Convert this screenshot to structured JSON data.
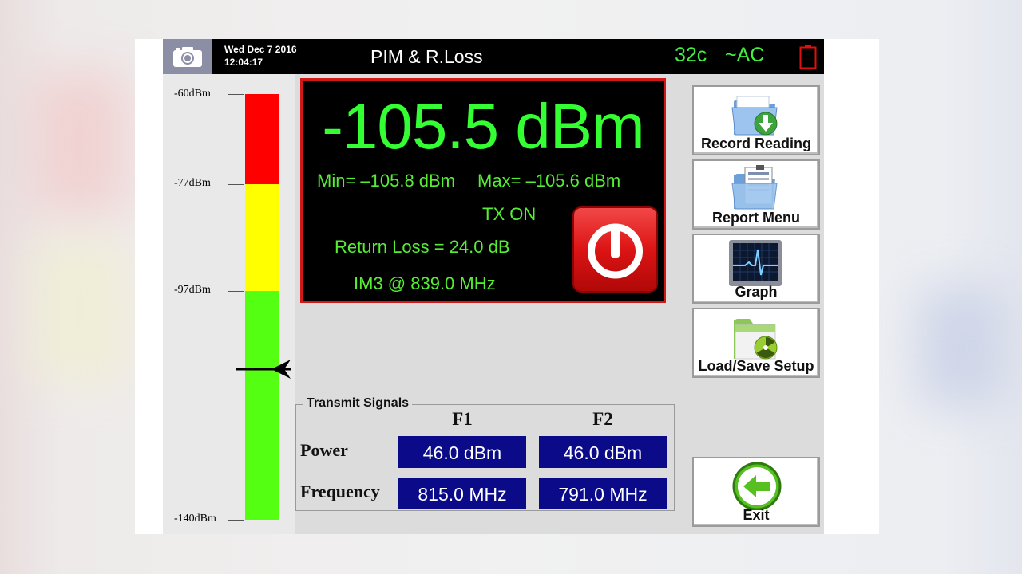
{
  "status_bar": {
    "date": "Wed Dec 7 2016",
    "time": "12:04:17",
    "title": "PIM & R.Loss",
    "temperature": "32c",
    "power_source": "~AC"
  },
  "meter": {
    "ticks": [
      "-60dBm",
      "-77dBm",
      "-97dBm",
      "-140dBm"
    ],
    "colors": {
      "red": "#ff0000",
      "yellow": "#ffff00",
      "green": "#55ff11"
    },
    "needle_level_dbm": -105.5
  },
  "reading": {
    "value": "-105.5 dBm",
    "min": "Min= –105.8 dBm",
    "max": "Max= –105.6 dBm",
    "tx_status": "TX ON",
    "return_loss": "Return Loss = 24.0 dB",
    "im3": "IM3 @ 839.0 MHz",
    "text_color": "#33ff33",
    "border_color": "#d01818"
  },
  "transmit": {
    "title": "Transmit Signals",
    "columns": [
      "F1",
      "F2"
    ],
    "rows": [
      {
        "label": "Power",
        "values": [
          "46.0 dBm",
          "46.0 dBm"
        ]
      },
      {
        "label": "Frequency",
        "values": [
          "815.0 MHz",
          "791.0 MHz"
        ]
      }
    ],
    "value_bg": "#0b0b8a"
  },
  "buttons": {
    "record": "Record Reading",
    "report": "Report Menu",
    "graph": "Graph",
    "loadsave": "Load/Save Setup",
    "exit": "Exit"
  },
  "icons": {
    "camera": "camera-icon",
    "battery": "battery-icon",
    "power": "power-icon",
    "record": "folder-download-icon",
    "report": "folder-report-icon",
    "graph": "monitor-heartbeat-icon",
    "loadsave": "folder-radiation-icon",
    "exit": "arrow-left-icon"
  }
}
